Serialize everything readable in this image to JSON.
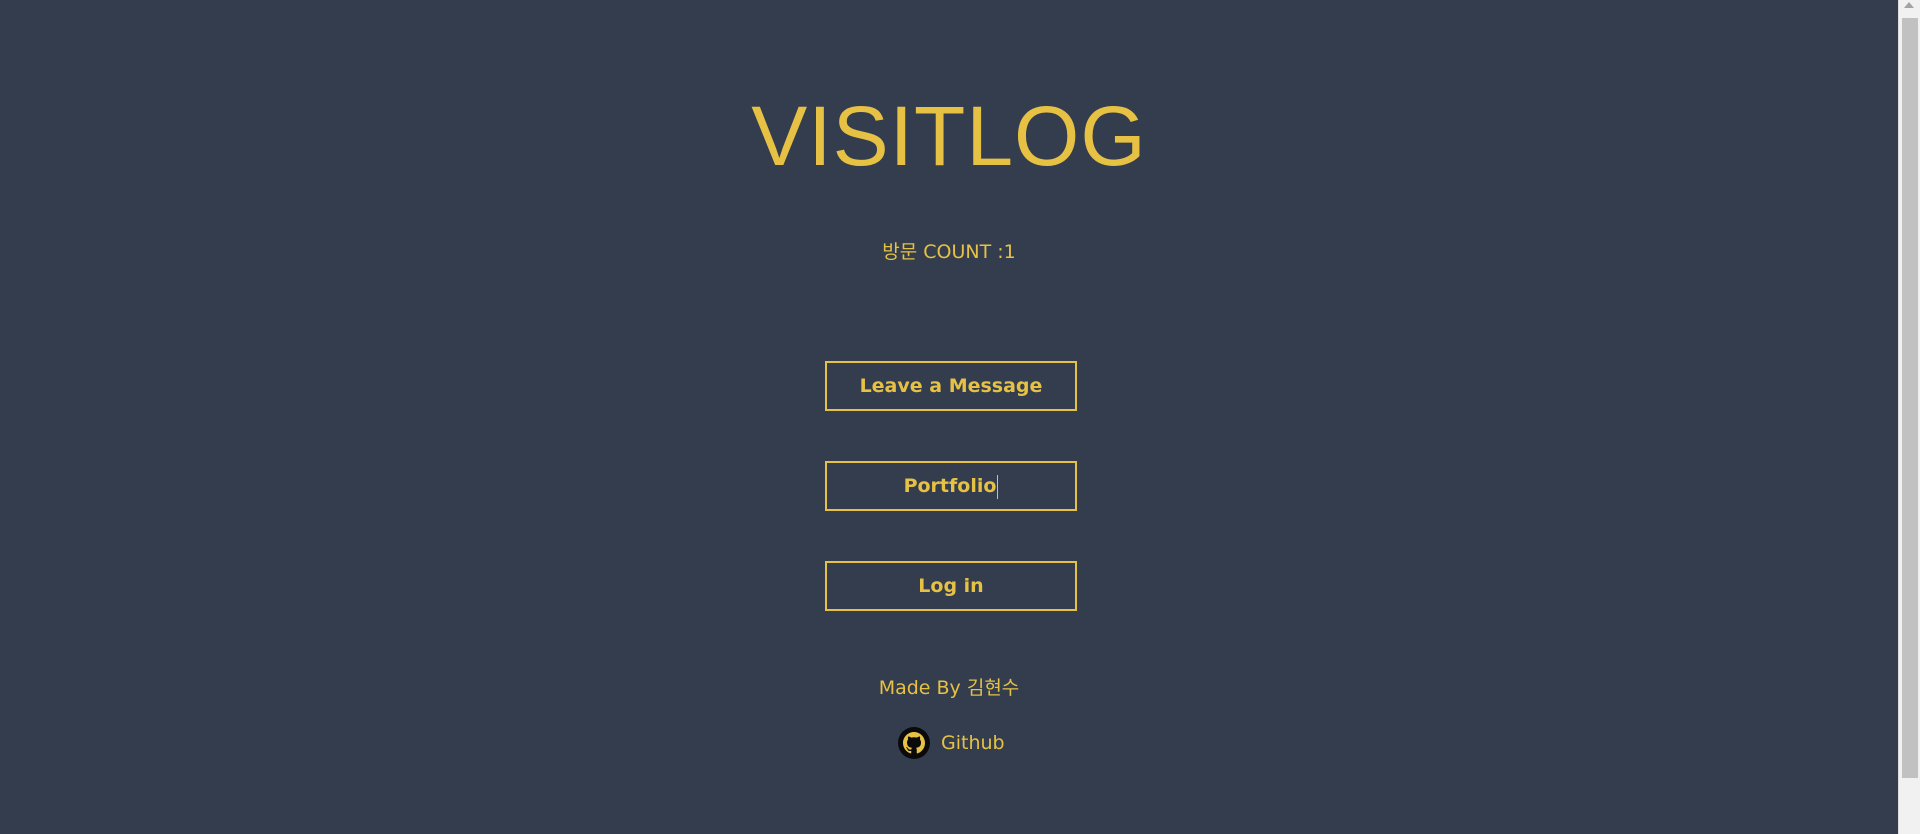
{
  "page": {
    "title": "VISITLOG",
    "count_label": "방문 COUNT :",
    "count_value": "1"
  },
  "menu": {
    "leave_message_label": "Leave a Message",
    "portfolio_label": "Portfolio",
    "login_label": "Log in"
  },
  "footer": {
    "made_by_label": "Made By ",
    "author_name": "김현수",
    "github_label": "Github",
    "github_icon": "github-icon"
  },
  "colors": {
    "background": "#333d4e",
    "accent": "#e6c144",
    "github_icon_bg": "#0a0a0a"
  }
}
